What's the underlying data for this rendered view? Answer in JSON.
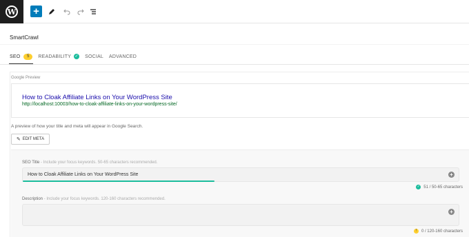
{
  "toolbar": {
    "logo_icon": "wordpress-logo",
    "add_label": "+",
    "icons": [
      "add-block-icon",
      "pencil-icon",
      "undo-icon",
      "redo-icon",
      "list-view-icon"
    ]
  },
  "panel": {
    "title": "SmartCrawl"
  },
  "tabs": [
    {
      "label": "SEO",
      "badge": "5",
      "active": true
    },
    {
      "label": "READABILITY",
      "badge": "✓"
    },
    {
      "label": "SOCIAL"
    },
    {
      "label": "ADVANCED"
    }
  ],
  "google_preview": {
    "label": "Google Preview",
    "title": "How to Cloak Affiliate Links on Your WordPress Site",
    "url": "http://localhost:10003/how-to-cloak-affiliate-links-on-your-wordpress-site/",
    "note": "A preview of how your title and meta will appear in Google Search."
  },
  "edit_meta": {
    "label": "EDIT META"
  },
  "seo_title": {
    "label": "SEO Title",
    "hint": " - Include your focus keywords. 50-65 characters recommended.",
    "value": "How to Cloak Affiliate Links on Your WordPress Site",
    "counter": "51 / 50-65 characters",
    "progress": 0.44
  },
  "description": {
    "label": "Description",
    "hint": " - Include your focus keywords. 120-160 characters recommended.",
    "value": "",
    "counter": "0 / 120-160 characters"
  },
  "colors": {
    "accent": "#007cba",
    "success": "#1abc9c",
    "warning": "#fecf2f",
    "link_title": "#1a0dab",
    "link_url": "#006621"
  }
}
